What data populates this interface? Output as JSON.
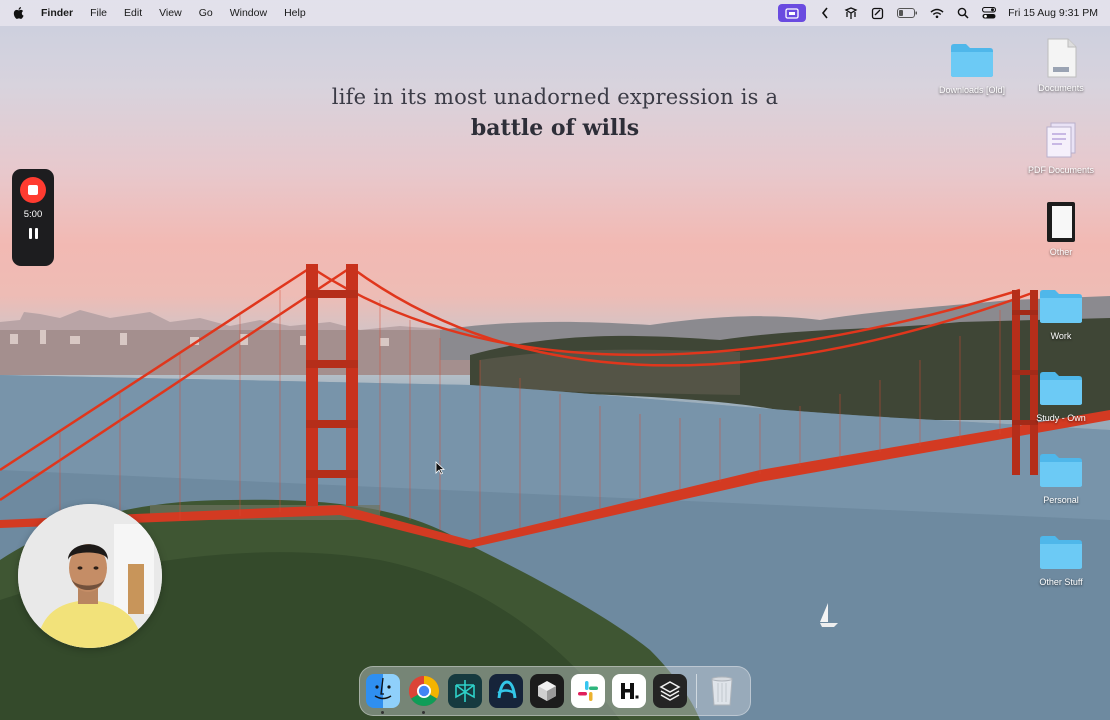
{
  "menubar": {
    "apple_icon": "apple-icon",
    "app_name": "Finder",
    "menus": [
      "File",
      "Edit",
      "View",
      "Go",
      "Window",
      "Help"
    ],
    "status_icons": [
      "screen-record-icon",
      "chevron-left-icon",
      "ai-assistant-icon",
      "notes-icon",
      "battery-icon",
      "wifi-icon",
      "search-icon",
      "control-center-icon"
    ],
    "datetime": "Fri 15 Aug  9:31 PM"
  },
  "wallpaper_quote": {
    "line1": "life in its most unadorned expression is a",
    "line2": "battle of wills"
  },
  "recorder": {
    "time": "5:00"
  },
  "desktop_icons": [
    {
      "label": "Downloads [Old]",
      "type": "folder"
    },
    {
      "label": "Documents",
      "type": "document"
    },
    {
      "label": "PDF Documents",
      "type": "document"
    },
    {
      "label": "Other",
      "type": "document"
    },
    {
      "label": "Work",
      "type": "folder"
    },
    {
      "label": "Study - Own",
      "type": "folder"
    },
    {
      "label": "Personal",
      "type": "folder"
    },
    {
      "label": "Other Stuff",
      "type": "folder"
    }
  ],
  "dock": {
    "apps": [
      "finder-icon",
      "chrome-icon",
      "perplexity-icon",
      "arc-icon",
      "cube-app-icon",
      "slack-icon",
      "hashnode-icon",
      "layers-app-icon"
    ],
    "trash": "trash-icon"
  },
  "colors": {
    "folder": "#5cc4f2",
    "record_red": "#ff3b30",
    "record_badge": "#6a4be0",
    "bridge": "#e0361c"
  }
}
